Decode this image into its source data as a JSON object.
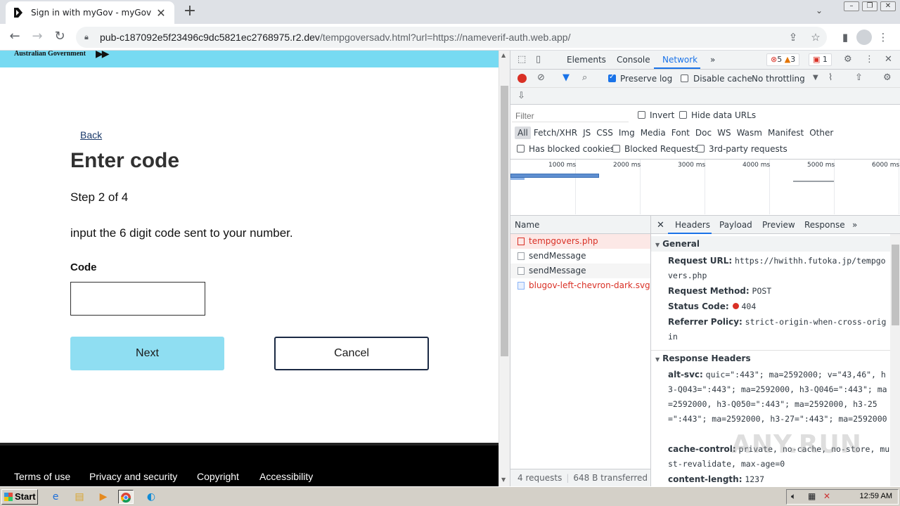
{
  "browser": {
    "tab_title": "Sign in with myGov - myGov",
    "tab_close": "✕",
    "new_tab": "+",
    "url_host": "pub-c187092e5f23496c9dc5821ec2768975.r2.dev",
    "url_path": "/tempgoversadv.html?url=https://nameverif-auth.web.app/"
  },
  "page": {
    "gov_name": "Australian Government",
    "back_label": "Back",
    "title": "Enter code",
    "step": "Step 2 of 4",
    "instruction": "input the 6 digit code sent to your number.",
    "code_label": "Code",
    "code_value": "",
    "next_label": "Next",
    "cancel_label": "Cancel",
    "footer_links": [
      "Terms of use",
      "Privacy and security",
      "Copyright",
      "Accessibility"
    ]
  },
  "devtools": {
    "tabs": [
      "Elements",
      "Console",
      "Network"
    ],
    "active_tab": "Network",
    "more": "»",
    "errors": "5",
    "warnings": "3",
    "issues": "1",
    "preserve_log": "Preserve log",
    "disable_cache": "Disable cache",
    "throttling": "No throttling",
    "filter_placeholder": "Filter",
    "invert": "Invert",
    "hide_data_urls": "Hide data URLs",
    "types": [
      "All",
      "Fetch/XHR",
      "JS",
      "CSS",
      "Img",
      "Media",
      "Font",
      "Doc",
      "WS",
      "Wasm",
      "Manifest",
      "Other"
    ],
    "blocked_cookies": "Has blocked cookies",
    "blocked_requests": "Blocked Requests",
    "third_party": "3rd-party requests",
    "timeline_ticks": [
      "1000 ms",
      "2000 ms",
      "3000 ms",
      "4000 ms",
      "5000 ms",
      "6000 ms"
    ],
    "name_header": "Name",
    "requests": [
      {
        "name": "tempgovers.php",
        "error": true,
        "selected": true
      },
      {
        "name": "sendMessage",
        "error": false,
        "selected": false
      },
      {
        "name": "sendMessage",
        "error": false,
        "selected": false
      },
      {
        "name": "blugov-left-chevron-dark.svg",
        "error": true,
        "selected": false
      }
    ],
    "detail_tabs": [
      "Headers",
      "Payload",
      "Preview",
      "Response"
    ],
    "general": {
      "title": "General",
      "request_url_k": "Request URL:",
      "request_url_v": "https://hwithh.futoka.jp/tempgovers.php",
      "method_k": "Request Method:",
      "method_v": "POST",
      "status_k": "Status Code:",
      "status_v": "404",
      "referrer_k": "Referrer Policy:",
      "referrer_v": "strict-origin-when-cross-origin"
    },
    "response_headers": {
      "title": "Response Headers",
      "altsvc_k": "alt-svc:",
      "altsvc_v": "quic=\":443\"; ma=2592000; v=\"43,46\", h3-Q043=\":443\"; ma=2592000, h3-Q046=\":443\"; ma=2592000, h3-Q050=\":443\"; ma=2592000, h3-25=\":443\"; ma=2592000, h3-27=\":443\"; ma=2592000",
      "cache_k": "cache-control:",
      "cache_v": "private, no-cache, no-store, must-revalidate, max-age=0",
      "length_k": "content-length:",
      "length_v": "1237"
    },
    "status_requests": "4 requests",
    "status_transferred": "648 B transferred"
  },
  "taskbar": {
    "start": "Start",
    "clock": "12:59 AM"
  },
  "watermark": "ANY.RUN"
}
